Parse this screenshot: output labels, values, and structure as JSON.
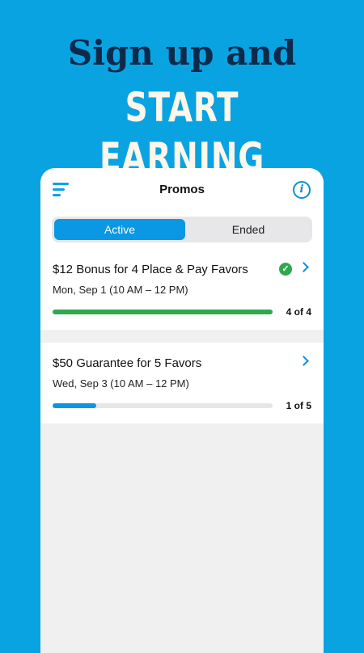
{
  "hero": {
    "line1": "Sign up and",
    "line2": "START EARNING"
  },
  "app": {
    "title": "Promos",
    "tabs": [
      {
        "label": "Active",
        "selected": true
      },
      {
        "label": "Ended",
        "selected": false
      }
    ],
    "promos": [
      {
        "title": "$12 Bonus for 4 Place & Pay Favors",
        "date": "Mon, Sep 1  (10 AM – 12 PM)",
        "completed": true,
        "progress_text": "4 of 4",
        "progress_value": 1.0,
        "progress_color": "#2fa84f"
      },
      {
        "title": "$50 Guarantee for 5 Favors",
        "date": "Wed, Sep 3  (10 AM – 12 PM)",
        "completed": false,
        "progress_text": "1 of 5",
        "progress_value": 0.2,
        "progress_color": "#0a97e3"
      }
    ]
  },
  "colors": {
    "background": "#0aa3e2",
    "accent": "#0a97e3",
    "success": "#2fa84f"
  },
  "icons": [
    "menu-icon",
    "info-icon",
    "check-icon",
    "chevron-right-icon"
  ]
}
